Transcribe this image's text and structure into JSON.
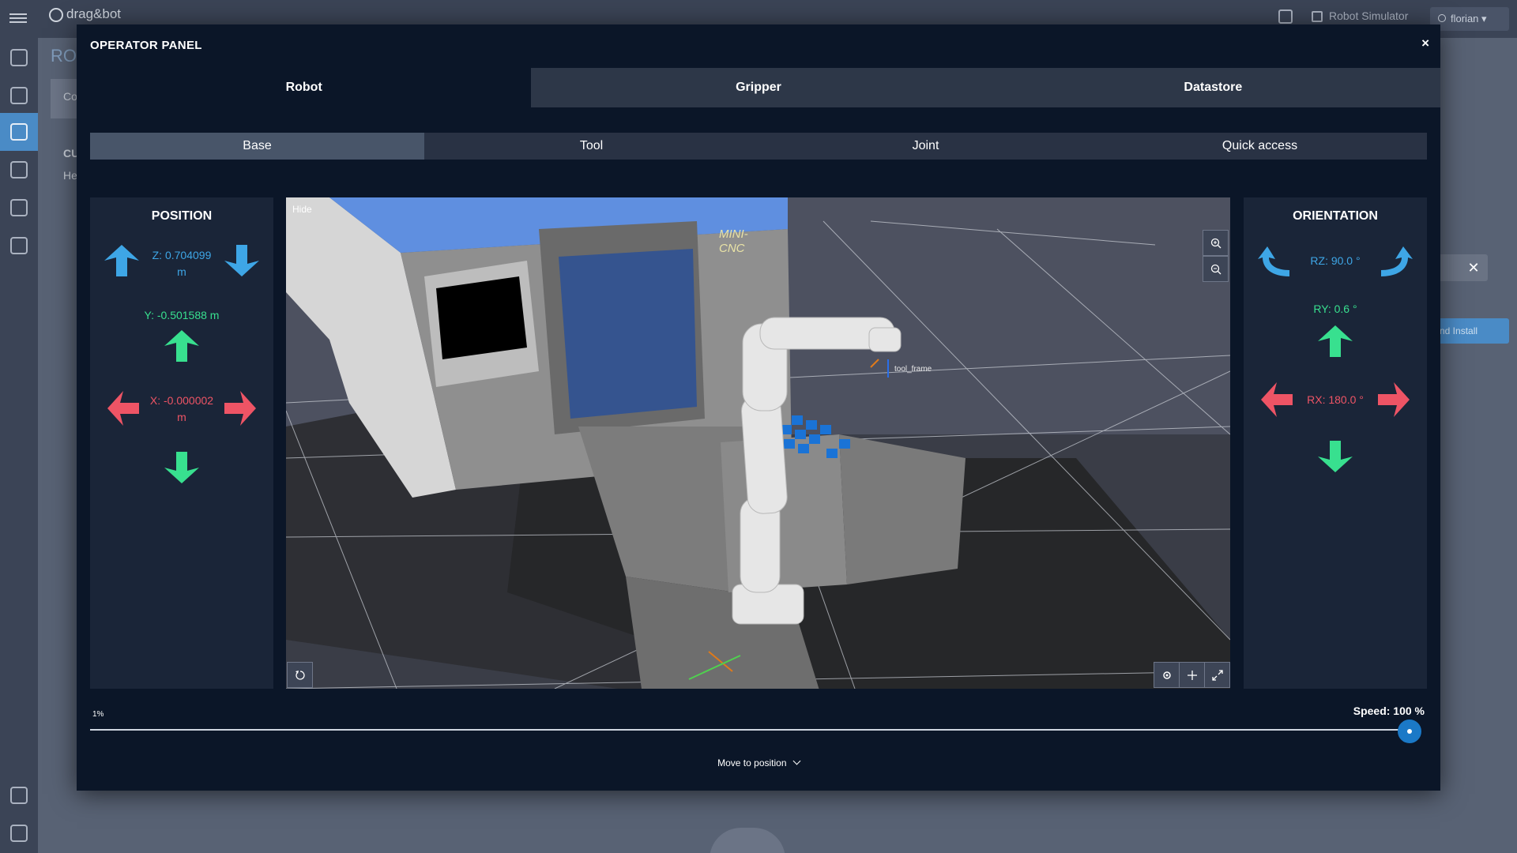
{
  "app": {
    "logo_text": "drag&bot",
    "robot_simulator_label": "Robot Simulator",
    "user_name": "florian",
    "bg_heading": "RO",
    "bg_card_text": "Co",
    "bg_section_title": "CU",
    "bg_section_sub": "He",
    "bg_install_label": "nd Install"
  },
  "modal": {
    "title": "OPERATOR PANEL",
    "close_icon": "×",
    "main_tabs": [
      {
        "label": "Robot",
        "active": true
      },
      {
        "label": "Gripper",
        "active": false
      },
      {
        "label": "Datastore",
        "active": false
      }
    ],
    "sub_tabs": [
      {
        "label": "Base",
        "active": true
      },
      {
        "label": "Tool",
        "active": false
      },
      {
        "label": "Joint",
        "active": false
      },
      {
        "label": "Quick access",
        "active": false
      }
    ]
  },
  "position": {
    "title": "POSITION",
    "z_line1": "Z: 0.704099",
    "z_line2": "m",
    "y_value": "Y: -0.501588 m",
    "x_line1": "X: -0.000002",
    "x_line2": "m"
  },
  "orientation": {
    "title": "ORIENTATION",
    "rz_value": "RZ: 90.0 °",
    "ry_value": "RY: 0.6 °",
    "rx_value": "RX: 180.0 °"
  },
  "viewport": {
    "hide_label": "Hide",
    "machine_label_line1": "MINI-",
    "machine_label_line2": "CNC",
    "tool_frame_label": "tool_frame"
  },
  "speed": {
    "min_label": "1%",
    "value_label": "Speed: 100 %",
    "value_fraction": 1.0
  },
  "move_to_position": "Move to position",
  "colors": {
    "modal_bg": "#0b1628",
    "panel_bg": "#1a2538",
    "blue_axis": "#3ea6e6",
    "green_axis": "#38e08f",
    "red_axis": "#ee5465",
    "slider_accent": "#1b79c7"
  },
  "icons": {
    "menu": "hamburger-icon",
    "zoom_in": "zoom-in-icon",
    "zoom_out": "zoom-out-icon",
    "reset_view": "reset-view-icon",
    "settings": "gear-icon",
    "move": "move-icon",
    "fullscreen": "expand-icon"
  }
}
